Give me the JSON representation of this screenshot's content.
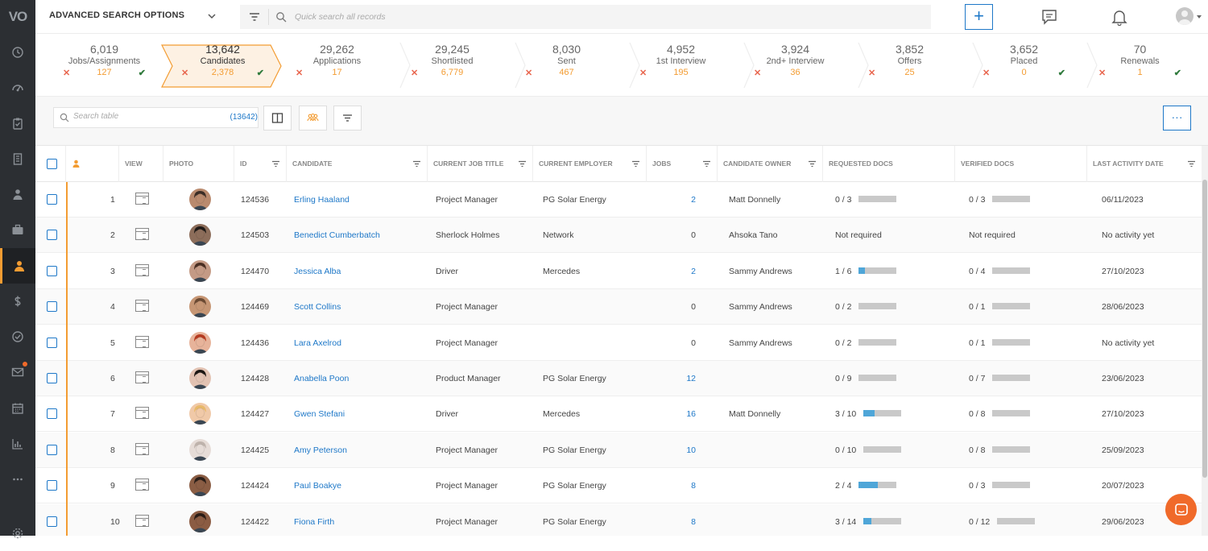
{
  "app": {
    "logo": "VO"
  },
  "sidebar": {
    "items": [
      {
        "icon": "history-icon"
      },
      {
        "icon": "dashboard-icon"
      },
      {
        "icon": "clipboard-icon"
      },
      {
        "icon": "building-icon"
      },
      {
        "icon": "contacts-icon"
      },
      {
        "icon": "briefcase-icon"
      },
      {
        "icon": "candidate-icon",
        "active": true
      },
      {
        "icon": "dollar-icon"
      },
      {
        "icon": "check-circle-icon"
      },
      {
        "icon": "mail-icon",
        "badge": true
      },
      {
        "icon": "calendar-icon"
      },
      {
        "icon": "reports-icon"
      },
      {
        "icon": "more-icon"
      },
      {
        "icon": "settings-icon"
      }
    ]
  },
  "topbar": {
    "advanced_search": "ADVANCED SEARCH OPTIONS",
    "quick_search_placeholder": "Quick search all records",
    "add_label": "+"
  },
  "pipeline": [
    {
      "count": "6,019",
      "label": "Jobs/Assignments",
      "value": "127",
      "check": true
    },
    {
      "count": "13,642",
      "label": "Candidates",
      "value": "2,378",
      "check": true,
      "active": true
    },
    {
      "count": "29,262",
      "label": "Applications",
      "value": "17",
      "check": false
    },
    {
      "count": "29,245",
      "label": "Shortlisted",
      "value": "6,779",
      "check": false
    },
    {
      "count": "8,030",
      "label": "Sent",
      "value": "467",
      "check": false
    },
    {
      "count": "4,952",
      "label": "1st Interview",
      "value": "195",
      "check": false
    },
    {
      "count": "3,924",
      "label": "2nd+ Interview",
      "value": "36",
      "check": false
    },
    {
      "count": "3,852",
      "label": "Offers",
      "value": "25",
      "check": false
    },
    {
      "count": "3,652",
      "label": "Placed",
      "value": "0",
      "check": true
    },
    {
      "count": "70",
      "label": "Renewals",
      "value": "1",
      "check": true
    }
  ],
  "toolbar": {
    "search_placeholder": "Search table",
    "search_count": "(13642)",
    "more_label": "···"
  },
  "table": {
    "headers": {
      "view": "VIEW",
      "photo": "PHOTO",
      "id": "ID",
      "candidate": "CANDIDATE",
      "job_title": "CURRENT JOB TITLE",
      "employer": "CURRENT EMPLOYER",
      "jobs": "JOBS",
      "owner": "CANDIDATE OWNER",
      "req_docs": "REQUESTED DOCS",
      "ver_docs": "VERIFIED DOCS",
      "last_activity": "LAST ACTIVITY DATE"
    },
    "rows": [
      {
        "n": "1",
        "id": "124536",
        "name": "Erling Haaland",
        "title": "Project Manager",
        "employer": "PG Solar Energy",
        "jobs": "2",
        "jobs_link": true,
        "owner": "Matt Donnelly",
        "req": "0 / 3",
        "req_frac": 0,
        "ver": "0 / 3",
        "ver_frac": 0,
        "last": "06/11/2023"
      },
      {
        "n": "2",
        "id": "124503",
        "name": "Benedict Cumberbatch",
        "title": "Sherlock Holmes",
        "employer": "Network",
        "jobs": "0",
        "jobs_link": false,
        "owner": "Ahsoka Tano",
        "req": "Not required",
        "req_frac": null,
        "ver": "Not required",
        "ver_frac": null,
        "last": "No activity yet"
      },
      {
        "n": "3",
        "id": "124470",
        "name": "Jessica Alba",
        "title": "Driver",
        "employer": "Mercedes",
        "jobs": "2",
        "jobs_link": true,
        "owner": "Sammy Andrews",
        "req": "1 / 6",
        "req_frac": 0.167,
        "ver": "0 / 4",
        "ver_frac": 0,
        "last": "27/10/2023"
      },
      {
        "n": "4",
        "id": "124469",
        "name": "Scott Collins",
        "title": "Project Manager",
        "employer": "",
        "jobs": "0",
        "jobs_link": false,
        "owner": "Sammy Andrews",
        "req": "0 / 2",
        "req_frac": 0,
        "ver": "0 / 1",
        "ver_frac": 0,
        "last": "28/06/2023"
      },
      {
        "n": "5",
        "id": "124436",
        "name": "Lara Axelrod",
        "title": "Project Manager",
        "employer": "",
        "jobs": "0",
        "jobs_link": false,
        "owner": "Sammy Andrews",
        "req": "0 / 2",
        "req_frac": 0,
        "ver": "0 / 1",
        "ver_frac": 0,
        "last": "No activity yet"
      },
      {
        "n": "6",
        "id": "124428",
        "name": "Anabella Poon",
        "title": "Product Manager",
        "employer": "PG Solar Energy",
        "jobs": "12",
        "jobs_link": true,
        "owner": "",
        "req": "0 / 9",
        "req_frac": 0,
        "ver": "0 / 7",
        "ver_frac": 0,
        "last": "23/06/2023"
      },
      {
        "n": "7",
        "id": "124427",
        "name": "Gwen Stefani",
        "title": "Driver",
        "employer": "Mercedes",
        "jobs": "16",
        "jobs_link": true,
        "owner": "Matt Donnelly",
        "req": "3 / 10",
        "req_frac": 0.3,
        "ver": "0 / 8",
        "ver_frac": 0,
        "last": "27/10/2023"
      },
      {
        "n": "8",
        "id": "124425",
        "name": "Amy Peterson",
        "title": "Project Manager",
        "employer": "PG Solar Energy",
        "jobs": "10",
        "jobs_link": true,
        "owner": "",
        "req": "0 / 10",
        "req_frac": 0,
        "ver": "0 / 8",
        "ver_frac": 0,
        "last": "25/09/2023"
      },
      {
        "n": "9",
        "id": "124424",
        "name": "Paul Boakye",
        "title": "Project Manager",
        "employer": "PG Solar Energy",
        "jobs": "8",
        "jobs_link": true,
        "owner": "",
        "req": "2 / 4",
        "req_frac": 0.5,
        "ver": "0 / 3",
        "ver_frac": 0,
        "last": "20/07/2023"
      },
      {
        "n": "10",
        "id": "124422",
        "name": "Fiona Firth",
        "title": "Project Manager",
        "employer": "PG Solar Energy",
        "jobs": "8",
        "jobs_link": true,
        "owner": "",
        "req": "3 / 14",
        "req_frac": 0.214,
        "ver": "0 / 12",
        "ver_frac": 0,
        "last": "29/06/2023"
      }
    ]
  },
  "colors": {
    "accent": "#f39c32",
    "link": "#1e78c8",
    "x": "#e8664e",
    "check": "#2f7a3c",
    "progress": "#4fa6d8"
  }
}
